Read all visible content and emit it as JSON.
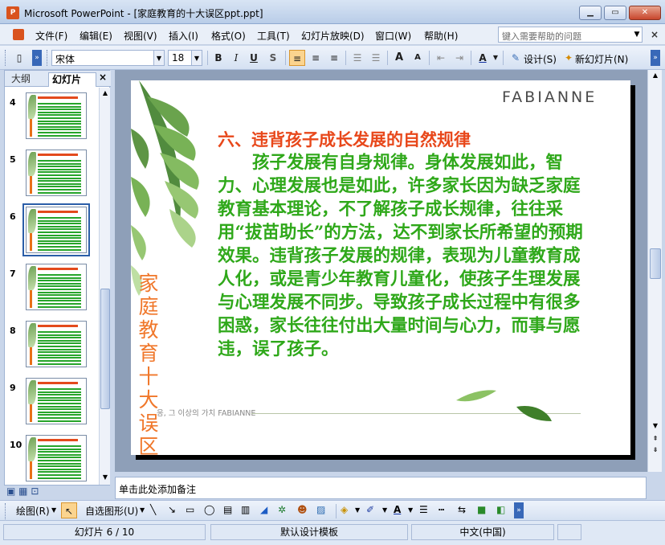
{
  "window": {
    "app_icon_text": "P",
    "title": "Microsoft PowerPoint - [家庭教育的十大误区ppt.ppt]",
    "min_glyph": "▁",
    "max_glyph": "▭",
    "close_glyph": "✕"
  },
  "menubar": {
    "items": [
      "文件(F)",
      "编辑(E)",
      "视图(V)",
      "插入(I)",
      "格式(O)",
      "工具(T)",
      "幻灯片放映(D)",
      "窗口(W)",
      "帮助(H)"
    ],
    "help_placeholder": "键入需要帮助的问题",
    "close_glyph": "×"
  },
  "format_toolbar": {
    "font_name": "宋体",
    "font_size": "18",
    "bold": "B",
    "italic": "I",
    "underline": "U",
    "shadow": "S",
    "increase_font": "A",
    "decrease_font": "A",
    "font_color": "A",
    "design_label": "设计(S)",
    "new_slide_label": "新幻灯片(N)"
  },
  "left_panel": {
    "tabs": [
      "大纲",
      "幻灯片"
    ],
    "close_glyph": "×",
    "slides": [
      {
        "number": "4",
        "selected": false
      },
      {
        "number": "5",
        "selected": false
      },
      {
        "number": "6",
        "selected": true
      },
      {
        "number": "7",
        "selected": false
      },
      {
        "number": "8",
        "selected": false
      },
      {
        "number": "9",
        "selected": false
      },
      {
        "number": "10",
        "selected": false
      }
    ]
  },
  "slide": {
    "logo": "FABIANNE",
    "title": "六、违背孩子成长发展的自然规律",
    "body": "孩子发展有自身规律。身体发展如此，智力、心理发展也是如此，许多家长因为缺乏家庭教育基本理论，不了解孩子成长规律，往往采用“拔苗助长”的方法，达不到家长所希望的预期效果。违背孩子发展的规律，表现为儿童教育成人化，或是青少年教育儿童化，使孩子生理发展与心理发展不同步。导致孩子成长过程中有很多困惑，家长往往付出大量时间与心力，而事与愿违，误了孩子。",
    "vertical_title": "家庭教育十大误区",
    "footer": "응, 그 이상의 가치  FABIANNE"
  },
  "notes": {
    "placeholder": "单击此处添加备注"
  },
  "drawing_toolbar": {
    "draw_label": "绘图(R)",
    "autoshapes_label": "自选图形(U)"
  },
  "status": {
    "slide_info": "幻灯片 6 / 10",
    "template": "默认设计模板",
    "language": "中文(中国)"
  },
  "colors": {
    "title_red": "#e8481b",
    "body_green": "#2fa81a",
    "vertical_orange": "#f0772a"
  }
}
